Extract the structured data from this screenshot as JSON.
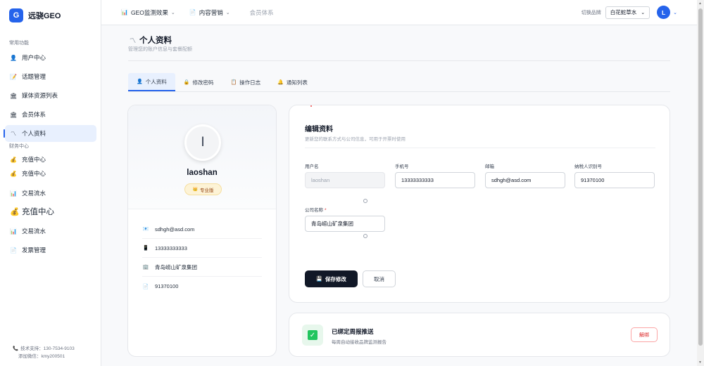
{
  "app": {
    "logo_letter": "G",
    "name": "远骁GEO"
  },
  "sidebar": {
    "section_1": "常用功能",
    "items_1": [
      {
        "icon": "user-icon",
        "glyph": "👤",
        "label": "用户中心"
      },
      {
        "icon": "topic-icon",
        "glyph": "📝",
        "label": "话题管理"
      },
      {
        "icon": "media-icon",
        "glyph": "🏛",
        "label": "媒体资源列表"
      },
      {
        "icon": "member-icon",
        "glyph": "🏛",
        "label": "会员体系"
      },
      {
        "icon": "profile-icon",
        "glyph": "〽",
        "label": "个人资料"
      }
    ],
    "section_2": "财务中心",
    "items_2": [
      {
        "icon": "money-bag-icon",
        "glyph": "💰",
        "label": "充值中心"
      },
      {
        "icon": "money-bag-icon",
        "glyph": "💰",
        "label": "充值中心"
      },
      {
        "icon": "chart-icon",
        "glyph": "📊",
        "label": "交易流水"
      },
      {
        "icon": "money-bag-icon",
        "glyph": "💰",
        "label": "充值中心"
      },
      {
        "icon": "chart-icon",
        "glyph": "📊",
        "label": "交易流水"
      },
      {
        "icon": "invoice-icon",
        "glyph": "📄",
        "label": "发票管理"
      }
    ],
    "footer_support": "技术支持：130-7534-9103",
    "footer_wechat": "添加微信：kmy200501"
  },
  "topbar": {
    "menus": [
      {
        "icon": "chart-icon",
        "glyph": "📊",
        "label": "GEO监测效果"
      },
      {
        "icon": "document-icon",
        "glyph": "📄",
        "label": "内容营销"
      },
      {
        "label": "会员体系"
      }
    ],
    "brand_label": "切换品牌",
    "brand_value": "白花蛇草水",
    "avatar_letter": "L"
  },
  "page": {
    "title": "个人资料",
    "subtitle": "管理您的账户信息与套餐配额"
  },
  "tabs": [
    {
      "icon": "user-icon",
      "glyph": "👤",
      "label": "个人资料"
    },
    {
      "icon": "lock-icon",
      "glyph": "🔒",
      "label": "修改密码"
    },
    {
      "icon": "log-icon",
      "glyph": "📋",
      "label": "操作日志"
    },
    {
      "icon": "bell-icon",
      "glyph": "🔔",
      "label": "通知列表"
    }
  ],
  "profile": {
    "avatar_letter": "I",
    "username": "laoshan",
    "badge": "专业版",
    "badge_glyph": "👑",
    "info": [
      {
        "icon": "email-icon",
        "glyph": "📧",
        "value": "sdhgh@asd.com"
      },
      {
        "icon": "phone-icon",
        "glyph": "📱",
        "value": "13333333333"
      },
      {
        "icon": "company-icon",
        "glyph": "🏢",
        "value": "青岛崂山矿泉集团"
      },
      {
        "icon": "tax-icon",
        "glyph": "📄",
        "value": "91370100"
      }
    ]
  },
  "edit": {
    "title": "编辑资料",
    "subtitle": "更新您的联系方式与公司信息，可用于开票时使用",
    "fields": {
      "username": {
        "label": "用户名",
        "value": "laoshan"
      },
      "phone": {
        "label": "手机号",
        "value": "13333333333"
      },
      "email": {
        "label": "邮箱",
        "value": "sdhgh@asd.com"
      },
      "tax_id": {
        "label": "纳税人识别号",
        "value": "91370100"
      },
      "company": {
        "label": "公司名称",
        "required_mark": "*",
        "value": "青岛崂山矿泉集团"
      }
    },
    "save_label": "保存修改",
    "save_glyph": "💾",
    "cancel_label": "取消"
  },
  "weekly": {
    "check_glyph": "✓",
    "title": "已绑定周报推送",
    "subtitle": "每周自动接收品牌监测报告",
    "unbind_label": "解绑"
  },
  "colors": {
    "primary": "#2563eb",
    "dark_button": "#111827",
    "danger": "#dc2626",
    "success": "#22c55e"
  }
}
